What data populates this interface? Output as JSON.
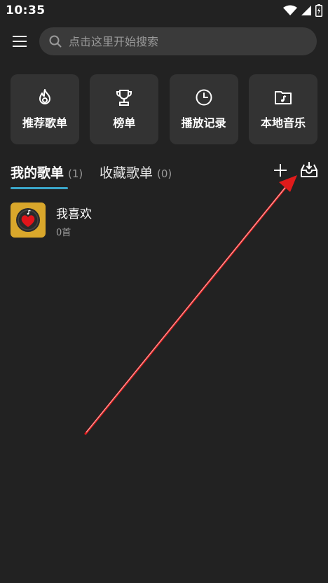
{
  "status_bar": {
    "time": "10:35",
    "icons": [
      "wifi-icon",
      "cellular-signal-icon",
      "battery-charging-icon"
    ]
  },
  "header": {
    "menu_icon": "hamburger-menu-icon",
    "search": {
      "placeholder": "点击这里开始搜索",
      "value": ""
    }
  },
  "quick_actions": [
    {
      "label": "推荐歌单",
      "icon": "flame-icon"
    },
    {
      "label": "榜单",
      "icon": "trophy-icon"
    },
    {
      "label": "播放记录",
      "icon": "clock-icon"
    },
    {
      "label": "本地音乐",
      "icon": "music-folder-icon"
    }
  ],
  "tabs": [
    {
      "label": "我的歌单",
      "count": "(1)",
      "active": true
    },
    {
      "label": "收藏歌单",
      "count": "(0)",
      "active": false
    }
  ],
  "toolbar": {
    "add_icon": "plus-icon",
    "import_icon": "inbox-download-icon"
  },
  "playlists": [
    {
      "name": "我喜欢",
      "count": "0首",
      "cover_icon": "heart-record-icon"
    }
  ],
  "colors": {
    "background": "#222222",
    "card": "#333333",
    "search_bg": "#3a3a3a",
    "accent": "#3aa6c9",
    "cover": "#d9a72b",
    "annotation": "#e01b1b"
  }
}
